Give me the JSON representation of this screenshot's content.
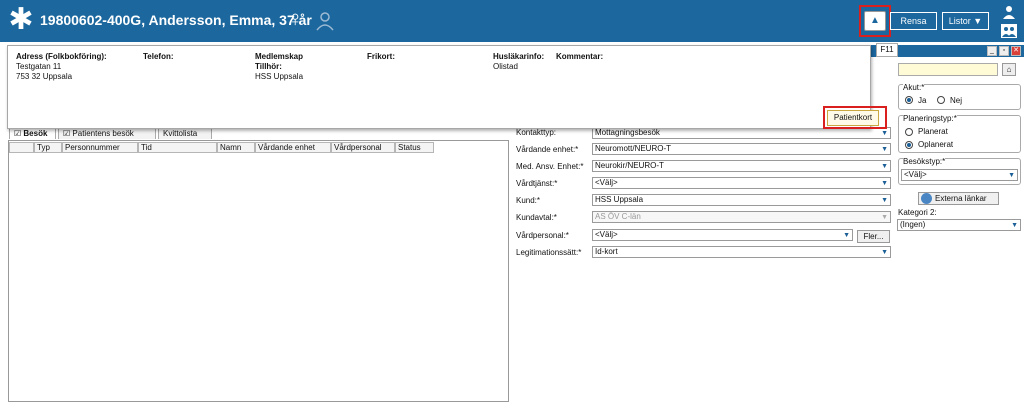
{
  "header": {
    "patient_title": "19800602-400G,  Andersson, Emma,  37 år",
    "rensa_label": "Rensa",
    "listor_label": "Listor ▼",
    "tooltip": "F11"
  },
  "info": {
    "adress_head": "Adress (Folkbokföring):",
    "adress_line1": "Testgatan 11",
    "adress_line2": "753 32 Uppsala",
    "telefon_head": "Telefon:",
    "medlemskap_head": "Medlemskap",
    "tillhor_head": "Tillhör:",
    "tillhor_value": "HSS Uppsala",
    "frikort_head": "Frikort:",
    "huslakare_head": "Husläkarinfo:",
    "huslakare_value": "Olistad",
    "kommentar_head": "Kommentar:",
    "patientkort_label": "Patientkort"
  },
  "tabs": [
    "Besök",
    "Patientens besök",
    "Kvittolista"
  ],
  "columns": [
    "Typ",
    "Personnummer",
    "Tid",
    "Namn",
    "Vårdande enhet",
    "Vårdpersonal",
    "Status"
  ],
  "form": {
    "kontakttyp_label": "Kontakttyp:",
    "kontakttyp_value": "Mottagningsbesök",
    "vardande_label": "Vårdande enhet:*",
    "vardande_value": "Neuromott/NEURO-T",
    "medansv_label": "Med. Ansv. Enhet:*",
    "medansv_value": "Neurokir/NEURO-T",
    "vardtjanst_label": "Vårdtjänst:*",
    "vardtjanst_value": "<Välj>",
    "kund_label": "Kund:*",
    "kund_value": "HSS Uppsala",
    "kundavtal_label": "Kundavtal:*",
    "kundavtal_value": "AS ÖV C-län",
    "vardpersonal_label": "Vårdpersonal:*",
    "vardpersonal_value": "<Välj>",
    "fler_label": "Fler...",
    "legit_label": "Legitimationssätt:*",
    "legit_value": "Id-kort"
  },
  "right": {
    "akut_label": "Akut:*",
    "ja_label": "Ja",
    "nej_label": "Nej",
    "planering_label": "Planeringstyp:*",
    "planerat_label": "Planerat",
    "oplanerat_label": "Oplanerat",
    "besokstyp_label": "Besökstyp:*",
    "besokstyp_value": "<Välj>",
    "externa_label": "Externa länkar",
    "kategori_label": "Kategori 2:",
    "kategori_value": "(Ingen)"
  }
}
